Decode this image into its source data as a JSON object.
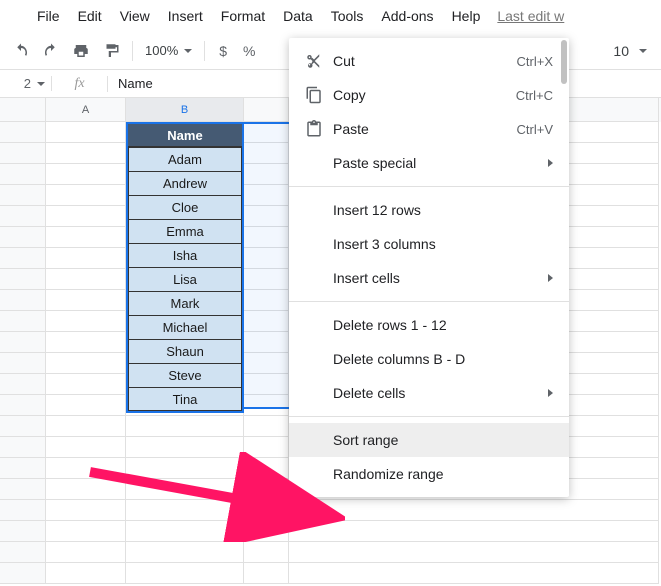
{
  "menubar": {
    "items": [
      "File",
      "Edit",
      "View",
      "Insert",
      "Format",
      "Data",
      "Tools",
      "Add-ons",
      "Help"
    ],
    "last_edit": "Last edit w"
  },
  "toolbar": {
    "zoom": "100%",
    "currency": "$",
    "percent": "%",
    "fontsize": "10"
  },
  "formula_bar": {
    "name_ref": "2",
    "fx_label": "fx",
    "value": "Name"
  },
  "columns": [
    "A",
    "B"
  ],
  "table": {
    "header": "Name",
    "rows": [
      "Adam",
      "Andrew",
      "Cloe",
      "Emma",
      "Isha",
      "Lisa",
      "Mark",
      "Michael",
      "Shaun",
      "Steve",
      "Tina"
    ]
  },
  "context_menu": {
    "cut": {
      "label": "Cut",
      "shortcut": "Ctrl+X"
    },
    "copy": {
      "label": "Copy",
      "shortcut": "Ctrl+C"
    },
    "paste": {
      "label": "Paste",
      "shortcut": "Ctrl+V"
    },
    "paste_special": "Paste special",
    "insert_rows": "Insert 12 rows",
    "insert_cols": "Insert 3 columns",
    "insert_cells": "Insert cells",
    "delete_rows": "Delete rows 1 - 12",
    "delete_cols": "Delete columns B - D",
    "delete_cells": "Delete cells",
    "sort_range": "Sort range",
    "randomize": "Randomize range"
  }
}
